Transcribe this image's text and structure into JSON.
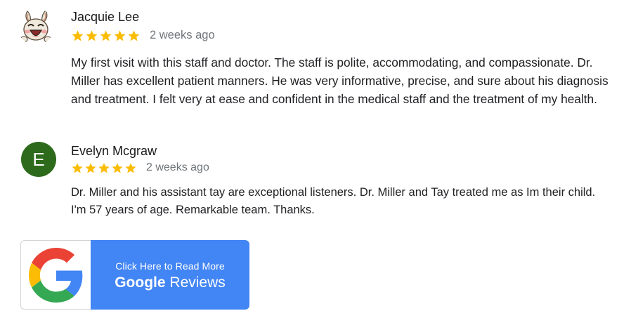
{
  "reviews": [
    {
      "name": "Jacquie Lee",
      "stars": 5,
      "date": "2 weeks ago",
      "text": "My first visit with this staff and doctor. The staff is polite, accommodating, and compassionate. Dr. Miller has excellent patient manners. He was very informative, precise, and sure about his diagnosis and treatment. I felt very at ease and confident in the medical staff and the treatment of my health.",
      "avatar": {
        "type": "image",
        "icon": "cartoon-rabbit-avatar-icon"
      }
    },
    {
      "name": "Evelyn Mcgraw",
      "stars": 5,
      "date": "2 weeks ago",
      "text": "Dr. Miller and his assistant tay are exceptional listeners. Dr. Miller and Tay treated me as Im their child. I'm 57 years of age. Remarkable team. Thanks.",
      "avatar": {
        "type": "letter",
        "letter": "E",
        "color": "#2d6a1c"
      }
    }
  ],
  "google_button": {
    "line1": "Click Here to Read More",
    "brand": "Google",
    "suffix": "Reviews",
    "icon": "google-g-logo-icon",
    "color": "#4285f4"
  },
  "colors": {
    "star": "#fbbc04",
    "date": "#70757a",
    "text": "#202124"
  }
}
